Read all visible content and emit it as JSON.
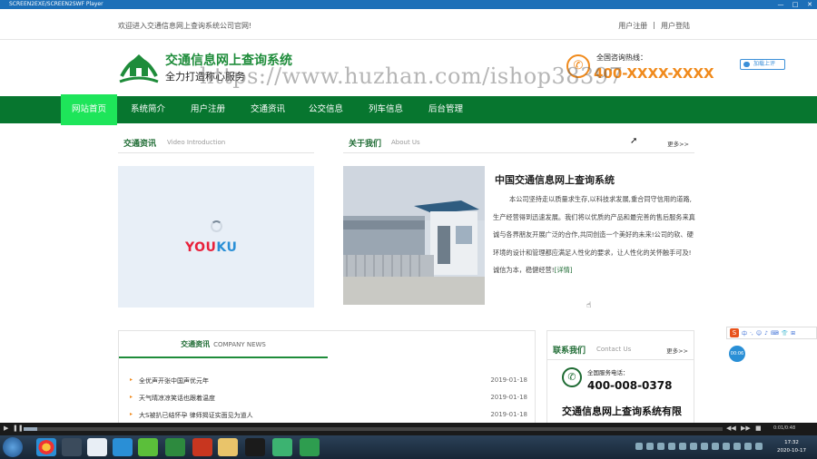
{
  "player": {
    "title": "SCREEN2EXE/SCREEN2SWF Player",
    "buttons": [
      "—",
      "□",
      "✕"
    ],
    "time_label": "0:01/0:48"
  },
  "topbar": {
    "welcome": "欢迎进入交通信息网上查询系统公司官网!",
    "register": "用户注册",
    "separator": "|",
    "login": "用户登陆"
  },
  "header": {
    "site_name": "交通信息网上查询系统",
    "slogan": "全力打造称心服务",
    "hotline_label": "全国咨询热线：",
    "hotline_number": "400-XXXX-XXXX",
    "share_label": "加载上评"
  },
  "watermark": "https://www.huzhan.com/ishop38397",
  "nav": {
    "items": [
      "网站首页",
      "系统简介",
      "用户注册",
      "交通资讯",
      "公交信息",
      "列车信息",
      "后台管理"
    ],
    "active_index": 0
  },
  "video_section": {
    "title": "交通资讯",
    "subtitle": "Video Introduction",
    "player_brand_main": "YOU",
    "player_brand_accent": "KU"
  },
  "about_section": {
    "title": "关于我们",
    "subtitle": "About Us",
    "more": "更多>>",
    "heading": "中国交通信息网上查询系统",
    "body": "本公司坚持走以质量求生存,以科技求发展,重合同守信用的道路,生产经营得到迅速发展。我们将以优质的产品和最完善的售后服务来真诚与各界朋友开展广泛的合作,共同创造一个美好的未来!公司的软、硬环境的设计和管理都应满足人性化的要求，让人性化的关怀触手可及!诚信为本，稳健经营!",
    "detail_link": "[详情]"
  },
  "news_section": {
    "title": "交通资讯",
    "subtitle": "COMPANY NEWS",
    "items": [
      {
        "title": "全优声开张中国声优元年",
        "date": "2019-01-18"
      },
      {
        "title": "天气晴凉凉笑话也跟着温度",
        "date": "2019-01-18"
      },
      {
        "title": "大S被扒已结怀孕 律师揭证实面见为道人",
        "date": "2019-01-18"
      }
    ]
  },
  "contact_section": {
    "title": "联系我们",
    "subtitle": "Contact Us",
    "more": "更多>>",
    "phone_label": "全国服务电话：",
    "phone_number": "400-008-0378",
    "company": "交通信息网上查询系统有限公司"
  },
  "overlay": {
    "ime_items": [
      "中",
      "·,",
      "☺",
      "♪",
      "⌨",
      "👕",
      "⊞"
    ],
    "badge": "00:06"
  },
  "taskbar": {
    "clock_time": "17:32",
    "clock_date": "2020-10-17"
  },
  "colors": {
    "nav_green": "#07762f",
    "nav_active": "#1ee55a",
    "brand_green": "#1e8c3a",
    "hotline_orange": "#f08a1c"
  }
}
